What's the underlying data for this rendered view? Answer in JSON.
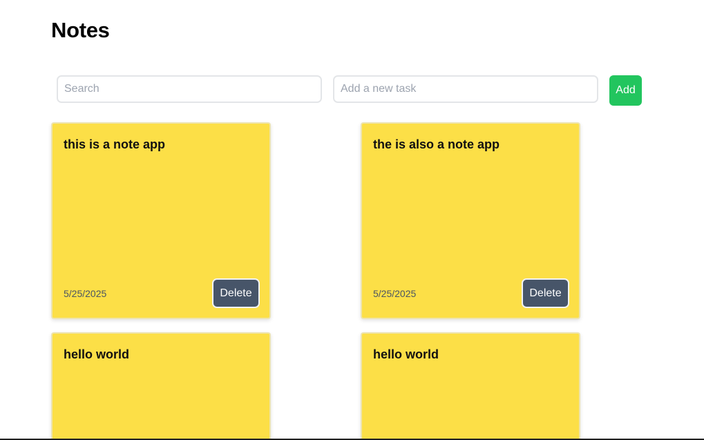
{
  "header": {
    "title": "Notes"
  },
  "toolbar": {
    "search_placeholder": "Search",
    "task_placeholder": "Add a new task",
    "add_label": "Add"
  },
  "notes": [
    {
      "text": "this is a note app",
      "date": "5/25/2025",
      "delete_label": "Delete"
    },
    {
      "text": "the is also a note app",
      "date": "5/25/2025",
      "delete_label": "Delete"
    },
    {
      "text": "hello world",
      "date": "",
      "delete_label": ""
    },
    {
      "text": "hello world",
      "date": "",
      "delete_label": ""
    }
  ],
  "colors": {
    "note_background": "#fcdf47",
    "add_button": "#22c55e",
    "delete_button": "#475569"
  }
}
